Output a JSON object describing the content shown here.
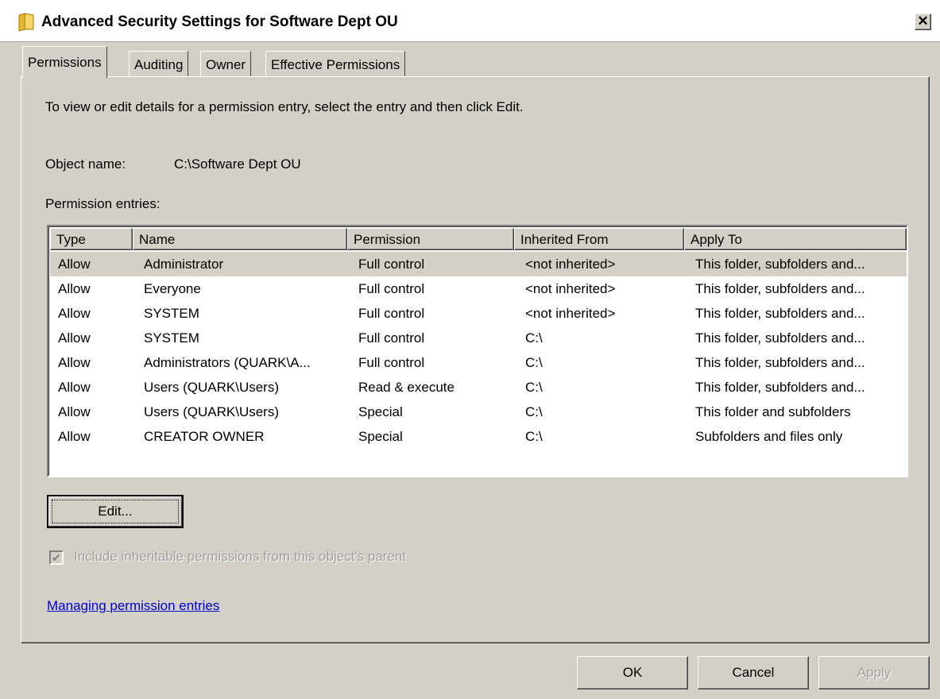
{
  "window": {
    "title": "Advanced Security Settings for Software Dept OU",
    "close_glyph": "✕"
  },
  "tabs": [
    {
      "label": "Permissions",
      "active": true
    },
    {
      "label": "Auditing",
      "active": false
    },
    {
      "label": "Owner",
      "active": false
    },
    {
      "label": "Effective Permissions",
      "active": false
    }
  ],
  "panel": {
    "instructions": "To view or edit details for a permission entry, select the entry and then click Edit.",
    "object_name_label": "Object name:",
    "object_name_value": "C:\\Software Dept OU",
    "entries_label": "Permission entries:"
  },
  "table": {
    "columns": [
      "Type",
      "Name",
      "Permission",
      "Inherited From",
      "Apply To"
    ],
    "rows": [
      [
        "Allow",
        "Administrator",
        "Full control",
        "<not inherited>",
        "This folder, subfolders and..."
      ],
      [
        "Allow",
        "Everyone",
        "Full control",
        "<not inherited>",
        "This folder, subfolders and..."
      ],
      [
        "Allow",
        "SYSTEM",
        "Full control",
        "<not inherited>",
        "This folder, subfolders and..."
      ],
      [
        "Allow",
        "SYSTEM",
        "Full control",
        "C:\\",
        "This folder, subfolders and..."
      ],
      [
        "Allow",
        "Administrators (QUARK\\A...",
        "Full control",
        "C:\\",
        "This folder, subfolders and..."
      ],
      [
        "Allow",
        "Users (QUARK\\Users)",
        "Read & execute",
        "C:\\",
        "This folder, subfolders and..."
      ],
      [
        "Allow",
        "Users (QUARK\\Users)",
        "Special",
        "C:\\",
        "This folder and subfolders"
      ],
      [
        "Allow",
        "CREATOR OWNER",
        "Special",
        "C:\\",
        "Subfolders and files only"
      ]
    ],
    "selected_row": 0
  },
  "edit_button": "Edit...",
  "inherit_checkbox": {
    "label": "Include inheritable permissions from this object's parent",
    "checked": true,
    "disabled": true
  },
  "help_link": "Managing permission entries",
  "footer": {
    "ok": "OK",
    "cancel": "Cancel",
    "apply": "Apply"
  }
}
